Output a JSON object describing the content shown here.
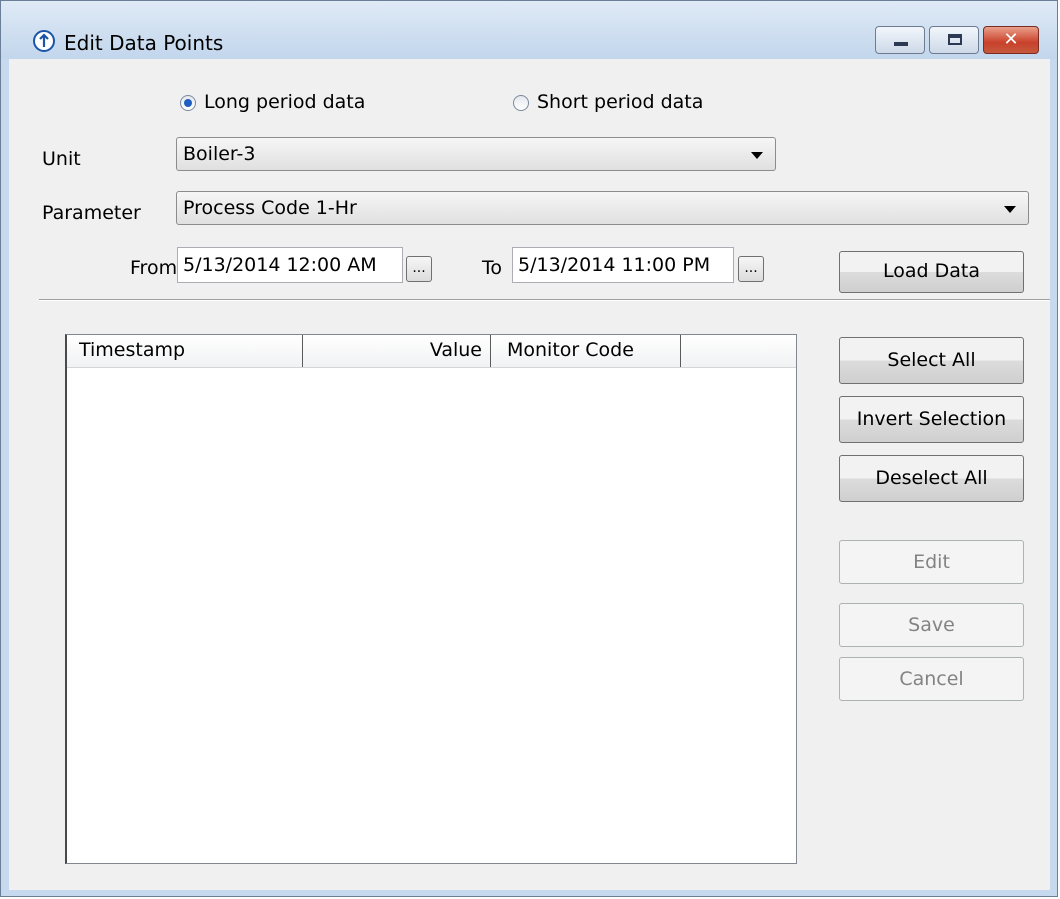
{
  "window": {
    "title": "Edit Data Points",
    "close_glyph": "✕"
  },
  "period": {
    "long_label": "Long period data",
    "short_label": "Short period data",
    "selected": "long"
  },
  "unit": {
    "label": "Unit",
    "value": "Boiler-3"
  },
  "parameter": {
    "label": "Parameter",
    "value": "Process Code 1-Hr"
  },
  "range": {
    "from_label": "From",
    "from_value": "5/13/2014 12:00 AM",
    "to_label": "To",
    "to_value": "5/13/2014 11:00 PM",
    "picker_label": "..."
  },
  "load_button": "Load Data",
  "table": {
    "columns": [
      "Timestamp",
      "Value",
      "Monitor Code"
    ],
    "rows": []
  },
  "side_buttons": {
    "select_all": "Select All",
    "invert_selection": "Invert Selection",
    "deselect_all": "Deselect All",
    "edit": "Edit",
    "save": "Save",
    "cancel": "Cancel"
  },
  "icons": {
    "app": "app-logo-icon",
    "minimize": "minimize-icon",
    "maximize": "maximize-icon",
    "close": "close-icon",
    "dropdown": "chevron-down-icon"
  }
}
